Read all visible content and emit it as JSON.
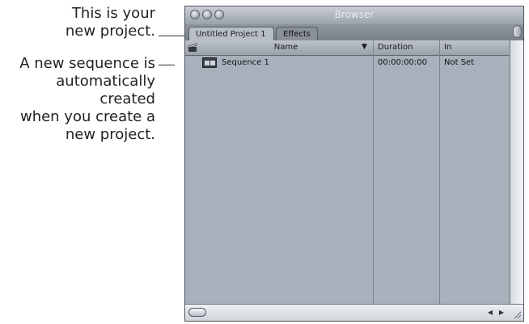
{
  "callouts": {
    "project_line1": "This is your",
    "project_line2": "new project.",
    "sequence_line1": "A new sequence is",
    "sequence_line2": "automatically created",
    "sequence_line3": "when you create a",
    "sequence_line4": "new project."
  },
  "window": {
    "title": "Browser"
  },
  "tabs": [
    {
      "label": "Untitled Project 1",
      "active": true
    },
    {
      "label": "Effects",
      "active": false
    }
  ],
  "columns": {
    "name": "Name",
    "duration": "Duration",
    "in": "In"
  },
  "rows": [
    {
      "name": "Sequence 1",
      "duration": "00:00:00:00",
      "in": "Not Set",
      "icon": "sequence-icon"
    }
  ],
  "colors": {
    "window_bg": "#a8b0bb"
  }
}
